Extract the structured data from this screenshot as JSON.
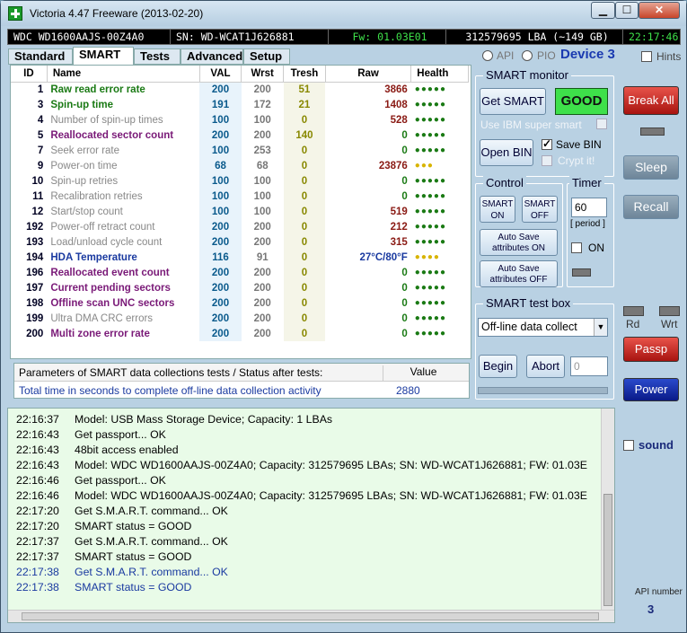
{
  "window": {
    "title": "Victoria 4.47   Freeware (2013-02-20)",
    "min_icon": "minimize-icon",
    "max_icon": "maximize-icon",
    "close_icon": "close-icon",
    "min_label": "▁",
    "max_label": "☐",
    "close_label": "✕"
  },
  "infobar": {
    "model": "WDC WD1600AAJS-00Z4A0",
    "serial": "SN: WD-WCAT1J626881",
    "firmware": "Fw: 01.03E01",
    "lba": "312579695 LBA (~149 GB)",
    "clock": "22:17:46"
  },
  "tabs": [
    "Standard",
    "SMART",
    "Tests",
    "Advanced",
    "Setup"
  ],
  "mode": {
    "api": "API",
    "pio": "PIO",
    "device": "Device 3",
    "hints": "Hints"
  },
  "smart_table": {
    "headers": [
      "ID",
      "Name",
      "VAL",
      "Wrst",
      "Tresh",
      "Raw",
      "Health"
    ],
    "rows": [
      {
        "id": "1",
        "name": "Raw read error rate",
        "val": "200",
        "wrst": "200",
        "tresh": "51",
        "raw": "3866",
        "health": "●●●●●",
        "name_color": "#1a7a14",
        "raw_color": "#8a1a14",
        "health_color": "#1a7a14"
      },
      {
        "id": "3",
        "name": "Spin-up time",
        "val": "191",
        "wrst": "172",
        "tresh": "21",
        "raw": "1408",
        "health": "●●●●●",
        "name_color": "#1a7a14",
        "raw_color": "#8a1a14",
        "health_color": "#1a7a14"
      },
      {
        "id": "4",
        "name": "Number of spin-up times",
        "val": "100",
        "wrst": "100",
        "tresh": "0",
        "raw": "528",
        "health": "●●●●●",
        "name_color": "#888888",
        "raw_color": "#8a1a14",
        "health_color": "#1a7a14"
      },
      {
        "id": "5",
        "name": "Reallocated sector count",
        "val": "200",
        "wrst": "200",
        "tresh": "140",
        "raw": "0",
        "health": "●●●●●",
        "name_color": "#7a1a78",
        "raw_color": "#1a7a14",
        "health_color": "#1a7a14"
      },
      {
        "id": "7",
        "name": "Seek error rate",
        "val": "100",
        "wrst": "253",
        "tresh": "0",
        "raw": "0",
        "health": "●●●●●",
        "name_color": "#888888",
        "raw_color": "#1a7a14",
        "health_color": "#1a7a14"
      },
      {
        "id": "9",
        "name": "Power-on time",
        "val": "68",
        "wrst": "68",
        "tresh": "0",
        "raw": "23876",
        "health": "●●●",
        "name_color": "#888888",
        "raw_color": "#8a1a14",
        "health_color": "#d8b400"
      },
      {
        "id": "10",
        "name": "Spin-up retries",
        "val": "100",
        "wrst": "100",
        "tresh": "0",
        "raw": "0",
        "health": "●●●●●",
        "name_color": "#888888",
        "raw_color": "#1a7a14",
        "health_color": "#1a7a14"
      },
      {
        "id": "11",
        "name": "Recalibration retries",
        "val": "100",
        "wrst": "100",
        "tresh": "0",
        "raw": "0",
        "health": "●●●●●",
        "name_color": "#888888",
        "raw_color": "#1a7a14",
        "health_color": "#1a7a14"
      },
      {
        "id": "12",
        "name": "Start/stop count",
        "val": "100",
        "wrst": "100",
        "tresh": "0",
        "raw": "519",
        "health": "●●●●●",
        "name_color": "#888888",
        "raw_color": "#8a1a14",
        "health_color": "#1a7a14"
      },
      {
        "id": "192",
        "name": "Power-off retract count",
        "val": "200",
        "wrst": "200",
        "tresh": "0",
        "raw": "212",
        "health": "●●●●●",
        "name_color": "#888888",
        "raw_color": "#8a1a14",
        "health_color": "#1a7a14"
      },
      {
        "id": "193",
        "name": "Load/unload cycle count",
        "val": "200",
        "wrst": "200",
        "tresh": "0",
        "raw": "315",
        "health": "●●●●●",
        "name_color": "#888888",
        "raw_color": "#8a1a14",
        "health_color": "#1a7a14"
      },
      {
        "id": "194",
        "name": "HDA Temperature",
        "val": "116",
        "wrst": "91",
        "tresh": "0",
        "raw": "27°C/80°F",
        "health": "●●●●",
        "name_color": "#1a3aa0",
        "raw_color": "#1a3aa0",
        "health_color": "#d8b400"
      },
      {
        "id": "196",
        "name": "Reallocated event count",
        "val": "200",
        "wrst": "200",
        "tresh": "0",
        "raw": "0",
        "health": "●●●●●",
        "name_color": "#7a1a78",
        "raw_color": "#1a7a14",
        "health_color": "#1a7a14"
      },
      {
        "id": "197",
        "name": "Current pending sectors",
        "val": "200",
        "wrst": "200",
        "tresh": "0",
        "raw": "0",
        "health": "●●●●●",
        "name_color": "#7a1a78",
        "raw_color": "#1a7a14",
        "health_color": "#1a7a14"
      },
      {
        "id": "198",
        "name": "Offline scan UNC sectors",
        "val": "200",
        "wrst": "200",
        "tresh": "0",
        "raw": "0",
        "health": "●●●●●",
        "name_color": "#7a1a78",
        "raw_color": "#1a7a14",
        "health_color": "#1a7a14"
      },
      {
        "id": "199",
        "name": "Ultra DMA CRC errors",
        "val": "200",
        "wrst": "200",
        "tresh": "0",
        "raw": "0",
        "health": "●●●●●",
        "name_color": "#888888",
        "raw_color": "#1a7a14",
        "health_color": "#1a7a14"
      },
      {
        "id": "200",
        "name": "Multi zone error rate",
        "val": "200",
        "wrst": "200",
        "tresh": "0",
        "raw": "0",
        "health": "●●●●●",
        "name_color": "#7a1a78",
        "raw_color": "#1a7a14",
        "health_color": "#1a7a14"
      }
    ]
  },
  "params": {
    "header": "Parameters of SMART data collections tests / Status after tests:",
    "value_header": "Value",
    "row_label": "Total time in seconds to complete off-line data collection activity",
    "row_value": "2880"
  },
  "smart_monitor": {
    "title": "SMART monitor",
    "get_smart": "Get SMART",
    "status": "GOOD",
    "ibm_label": "Use IBM super smart",
    "open_bin": "Open BIN",
    "save_bin": "Save BIN",
    "crypt": "Crypt it!"
  },
  "control": {
    "title": "Control",
    "smart_on": "SMART ON",
    "smart_off": "SMART OFF",
    "auto_on": "Auto Save attributes ON",
    "auto_off": "Auto Save attributes OFF"
  },
  "timer": {
    "title": "Timer",
    "value": "60",
    "period": "[ period ]",
    "on": "ON"
  },
  "test_box": {
    "title": "SMART test box",
    "selected": "Off-line data collect",
    "begin": "Begin",
    "abort": "Abort",
    "num": "0"
  },
  "right": {
    "break_all": "Break All",
    "sleep": "Sleep",
    "recall": "Recall",
    "rd": "Rd",
    "wrt": "Wrt",
    "passp": "Passp",
    "power": "Power",
    "sound": "sound",
    "api_number_label": "API number",
    "api_number": "3"
  },
  "log": [
    {
      "time": "22:16:37",
      "msg": "Model: USB Mass Storage Device; Capacity: 1 LBAs",
      "color": "#000000"
    },
    {
      "time": "22:16:43",
      "msg": "Get passport... OK",
      "color": "#000000"
    },
    {
      "time": "22:16:43",
      "msg": "48bit access enabled",
      "color": "#000000"
    },
    {
      "time": "22:16:43",
      "msg": "Model: WDC WD1600AAJS-00Z4A0; Capacity: 312579695 LBAs; SN: WD-WCAT1J626881; FW: 01.03E",
      "color": "#000000"
    },
    {
      "time": "22:16:46",
      "msg": "Get passport... OK",
      "color": "#000000"
    },
    {
      "time": "22:16:46",
      "msg": "Model: WDC WD1600AAJS-00Z4A0; Capacity: 312579695 LBAs; SN: WD-WCAT1J626881; FW: 01.03E",
      "color": "#000000"
    },
    {
      "time": "22:17:20",
      "msg": "Get S.M.A.R.T. command... OK",
      "color": "#000000"
    },
    {
      "time": "22:17:20",
      "msg": "SMART status = GOOD",
      "color": "#000000"
    },
    {
      "time": "22:17:37",
      "msg": "Get S.M.A.R.T. command... OK",
      "color": "#000000"
    },
    {
      "time": "22:17:37",
      "msg": "SMART status = GOOD",
      "color": "#000000"
    },
    {
      "time": "22:17:38",
      "msg": "Get S.M.A.R.T. command... OK",
      "color": "#1a3aa0"
    },
    {
      "time": "22:17:38",
      "msg": "SMART status = GOOD",
      "color": "#1a3aa0"
    }
  ]
}
